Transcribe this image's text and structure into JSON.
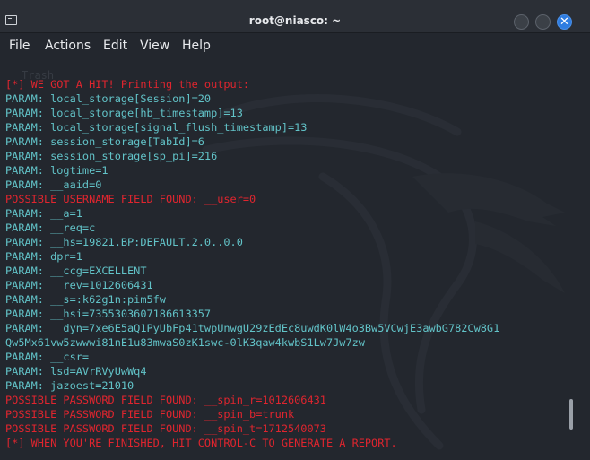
{
  "window": {
    "title": "root@niasco: ~",
    "close_glyph": "✕"
  },
  "menu": {
    "items": [
      "File",
      "Actions",
      "Edit",
      "View",
      "Help"
    ]
  },
  "terminal": {
    "faded_line": "Trash",
    "lines": [
      {
        "text": "[*] WE GOT A HIT! Printing the output:",
        "color": "red"
      },
      {
        "text": "PARAM: local_storage[Session]=20",
        "color": "cyan"
      },
      {
        "text": "PARAM: local_storage[hb_timestamp]=13",
        "color": "cyan"
      },
      {
        "text": "PARAM: local_storage[signal_flush_timestamp]=13",
        "color": "cyan"
      },
      {
        "text": "PARAM: session_storage[TabId]=6",
        "color": "cyan"
      },
      {
        "text": "PARAM: session_storage[sp_pi]=216",
        "color": "cyan"
      },
      {
        "text": "PARAM: logtime=1",
        "color": "cyan"
      },
      {
        "text": "PARAM: __aaid=0",
        "color": "cyan"
      },
      {
        "text": "POSSIBLE USERNAME FIELD FOUND: __user=0",
        "color": "red"
      },
      {
        "text": "PARAM: __a=1",
        "color": "cyan"
      },
      {
        "text": "PARAM: __req=c",
        "color": "cyan"
      },
      {
        "text": "PARAM: __hs=19821.BP:DEFAULT.2.0..0.0",
        "color": "cyan"
      },
      {
        "text": "PARAM: dpr=1",
        "color": "cyan"
      },
      {
        "text": "PARAM: __ccg=EXCELLENT",
        "color": "cyan"
      },
      {
        "text": "PARAM: __rev=1012606431",
        "color": "cyan"
      },
      {
        "text": "PARAM: __s=:k62g1n:pim5fw",
        "color": "cyan"
      },
      {
        "text": "PARAM: __hsi=7355303607186613357",
        "color": "cyan"
      },
      {
        "text": "PARAM: __dyn=7xe6E5aQ1PyUbFp41twpUnwgU29zEdEc8uwdK0lW4o3Bw5VCwjE3awbG782Cw8G1",
        "color": "cyan"
      },
      {
        "text": "Qw5Mx61vw5zwwwi81nE1u83mwaS0zK1swc-0lK3qaw4kwbS1Lw7Jw7zw",
        "color": "cyan"
      },
      {
        "text": "PARAM: __csr=",
        "color": "cyan"
      },
      {
        "text": "PARAM: lsd=AVrRVyUwWq4",
        "color": "cyan"
      },
      {
        "text": "PARAM: jazoest=21010",
        "color": "cyan"
      },
      {
        "text": "POSSIBLE PASSWORD FIELD FOUND: __spin_r=1012606431",
        "color": "red"
      },
      {
        "text": "POSSIBLE PASSWORD FIELD FOUND: __spin_b=trunk",
        "color": "red"
      },
      {
        "text": "POSSIBLE PASSWORD FIELD FOUND: __spin_t=1712540073",
        "color": "red"
      },
      {
        "text": "[*] WHEN YOU'RE FINISHED, HIT CONTROL-C TO GENERATE A REPORT.",
        "color": "red"
      }
    ]
  },
  "colors": {
    "cyan_text": "#62c3c8",
    "red_text": "#e0252e",
    "background": "#23272e",
    "close_button": "#2f7de1"
  },
  "icons": {
    "app_icon": "terminal-icon",
    "minimize": "minimize-icon",
    "maximize": "maximize-icon",
    "close": "close-icon",
    "background": "kali-dragon-watermark"
  }
}
